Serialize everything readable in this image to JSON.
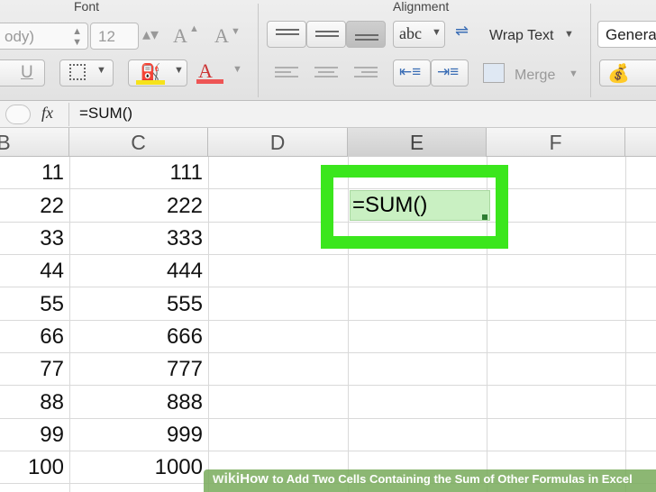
{
  "ribbon": {
    "font_group_label": "Font",
    "alignment_group_label": "Alignment",
    "font_name": "ody)",
    "font_size": "12",
    "grow_font": "A",
    "shrink_font": "A",
    "underline": "U",
    "text_style": "abc",
    "wrap_text": "Wrap Text",
    "merge": "Merge",
    "number_format": "Genera"
  },
  "formula_bar": {
    "fx_label": "fx",
    "formula": "=SUM()"
  },
  "columns": [
    "B",
    "C",
    "D",
    "E",
    "F"
  ],
  "active_column": "E",
  "rows": [
    {
      "b": "11",
      "c": "111"
    },
    {
      "b": "22",
      "c": "222"
    },
    {
      "b": "33",
      "c": "333"
    },
    {
      "b": "44",
      "c": "444"
    },
    {
      "b": "55",
      "c": "555"
    },
    {
      "b": "66",
      "c": "666"
    },
    {
      "b": "77",
      "c": "777"
    },
    {
      "b": "88",
      "c": "888"
    },
    {
      "b": "99",
      "c": "999"
    },
    {
      "b": "100",
      "c": "1000"
    }
  ],
  "active_cell": {
    "value": "=SUM()"
  },
  "caption": {
    "brand": "wiki",
    "how": "How",
    "text": "to Add Two Cells Containing the Sum of Other Formulas in Excel"
  },
  "colors": {
    "highlight": "#3be61d",
    "active_cell_fill": "#c9f0c2"
  }
}
